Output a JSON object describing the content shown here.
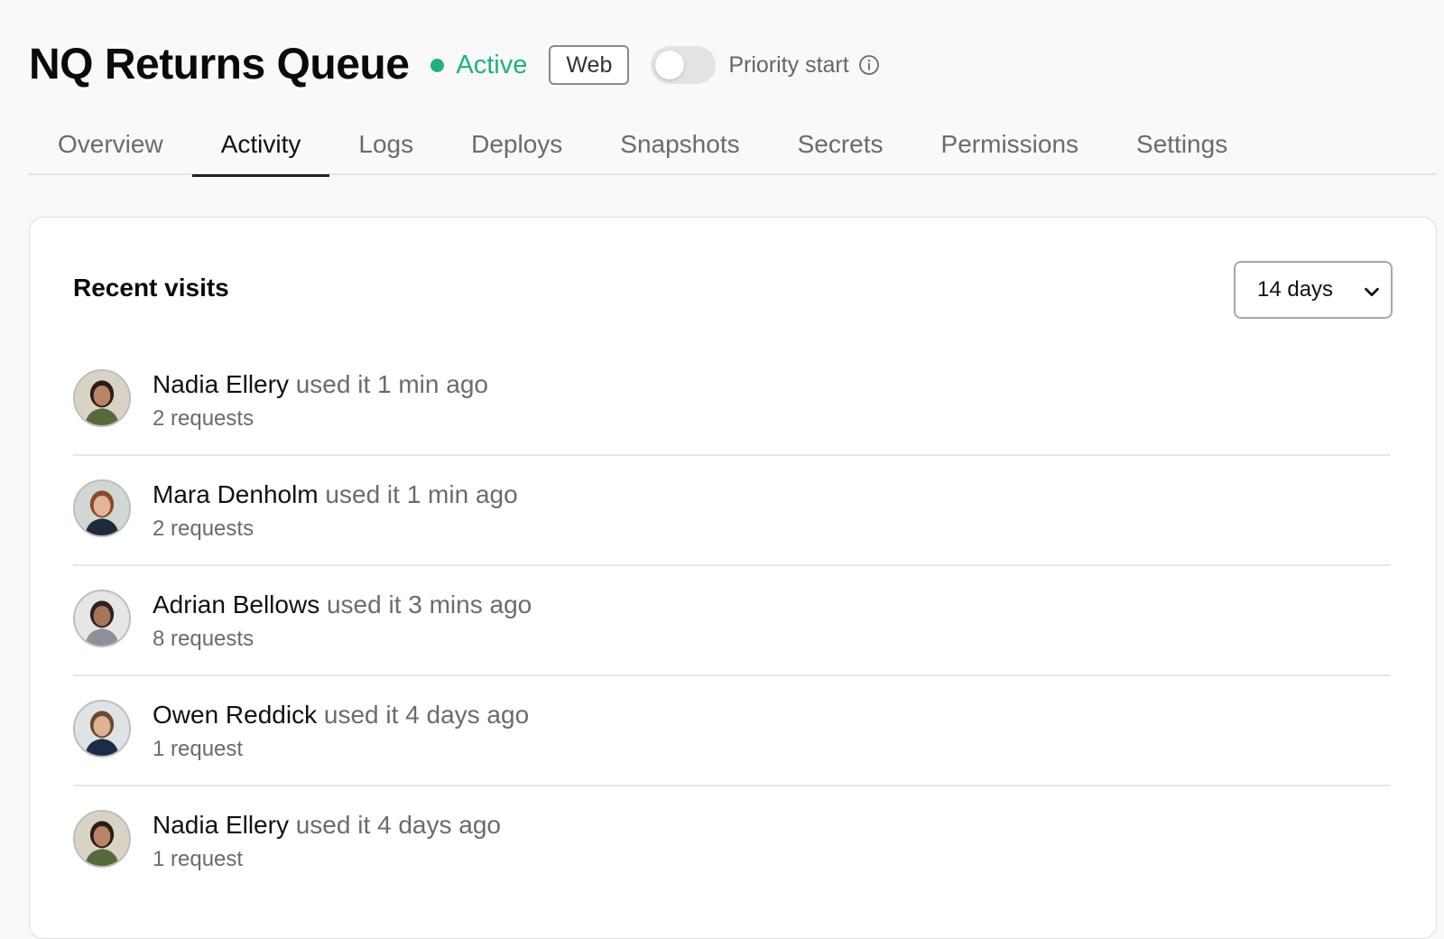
{
  "header": {
    "title": "NQ Returns Queue",
    "status": {
      "label": "Active",
      "color": "#1fb37a"
    },
    "badge": "Web",
    "toggle": {
      "label": "Priority start",
      "on": false
    }
  },
  "tabs": [
    {
      "label": "Overview",
      "active": false
    },
    {
      "label": "Activity",
      "active": true
    },
    {
      "label": "Logs",
      "active": false
    },
    {
      "label": "Deploys",
      "active": false
    },
    {
      "label": "Snapshots",
      "active": false
    },
    {
      "label": "Secrets",
      "active": false
    },
    {
      "label": "Permissions",
      "active": false
    },
    {
      "label": "Settings",
      "active": false
    }
  ],
  "recent": {
    "title": "Recent visits",
    "range_select": {
      "selected": "14 days"
    },
    "visits": [
      {
        "name": "Nadia Ellery",
        "when": "used it 1 min ago",
        "requests": "2 requests",
        "avatar": {
          "bg": "#d9d3c6",
          "hair": "#2a1d16",
          "skin": "#b98466",
          "shirt": "#556b3a"
        }
      },
      {
        "name": "Mara Denholm",
        "when": "used it 1 min ago",
        "requests": "2 requests",
        "avatar": {
          "bg": "#cfd8d2",
          "hair": "#8a4a2c",
          "skin": "#e2b49b",
          "shirt": "#1f2a3a"
        }
      },
      {
        "name": "Adrian Bellows",
        "when": "used it 3 mins ago",
        "requests": "8 requests",
        "avatar": {
          "bg": "#e6e6e4",
          "hair": "#2d2320",
          "skin": "#a8745a",
          "shirt": "#8b9199"
        }
      },
      {
        "name": "Owen Reddick",
        "when": "used it 4 days ago",
        "requests": "1 request",
        "avatar": {
          "bg": "#dfe3e6",
          "hair": "#6a4a30",
          "skin": "#e0b293",
          "shirt": "#1c2c46"
        }
      },
      {
        "name": "Nadia Ellery",
        "when": "used it 4 days ago",
        "requests": "1 request",
        "avatar": {
          "bg": "#d9d3c6",
          "hair": "#2a1d16",
          "skin": "#b98466",
          "shirt": "#556b3a"
        }
      }
    ]
  }
}
